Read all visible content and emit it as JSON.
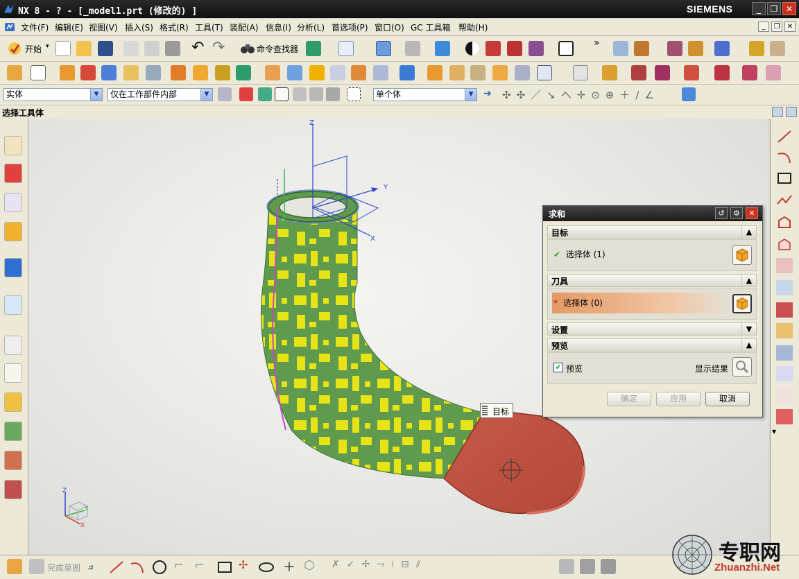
{
  "window": {
    "title": "NX 8 - ? - [_model1.prt  (修改的) ]",
    "brand": "SIEMENS",
    "buttons": {
      "minimize": "_",
      "restore": "❐",
      "close": "✕"
    }
  },
  "menubar": {
    "items": [
      "文件(F)",
      "编辑(E)",
      "视图(V)",
      "插入(S)",
      "格式(R)",
      "工具(T)",
      "装配(A)",
      "信息(I)",
      "分析(L)",
      "首选项(P)",
      "窗口(O)",
      "GC 工具箱",
      "帮助(H)"
    ]
  },
  "toolbar1": {
    "start_label": "开始",
    "command_finder_label": "命令查找器",
    "overflow": "»"
  },
  "selection_bar": {
    "type_filter": "实体",
    "scope_filter": "仅在工作部件内部",
    "body_rule": "单个体"
  },
  "cue_line": "选择工具体",
  "viewport": {
    "triad_labels": {
      "z": "Z",
      "y": "Y",
      "x": "X"
    },
    "wcs_labels": {
      "z": "Z",
      "y": "Y",
      "x": "X"
    },
    "tooltip": "目标"
  },
  "dialog": {
    "title": "求和",
    "sections": {
      "target": {
        "header": "目标",
        "row_label": "选择体 (1)",
        "check": "✔"
      },
      "tool": {
        "header": "刀具",
        "row_label": "选择体 (0)",
        "required_mark": "*"
      },
      "settings": {
        "header": "设置"
      },
      "preview": {
        "header": "预览",
        "checkbox_label": "预览",
        "checked": true,
        "show_result_label": "显示结果"
      }
    },
    "buttons": {
      "ok": "确定",
      "apply": "应用",
      "cancel": "取消"
    }
  },
  "bottom_bar": {
    "finish_sketch_label": "完成草图"
  },
  "watermark": {
    "text_cn": "专职网",
    "url": "Zhuanzhi.Net"
  },
  "colors": {
    "target_body": "#5f9a4e",
    "target_overlay": "#e6e316",
    "tool_face": "#c95040",
    "tool_row_highlight": "#e8a878",
    "dialog_title": "#1c1c1c",
    "titlebar": "#141414",
    "close_button": "#c8321f"
  }
}
